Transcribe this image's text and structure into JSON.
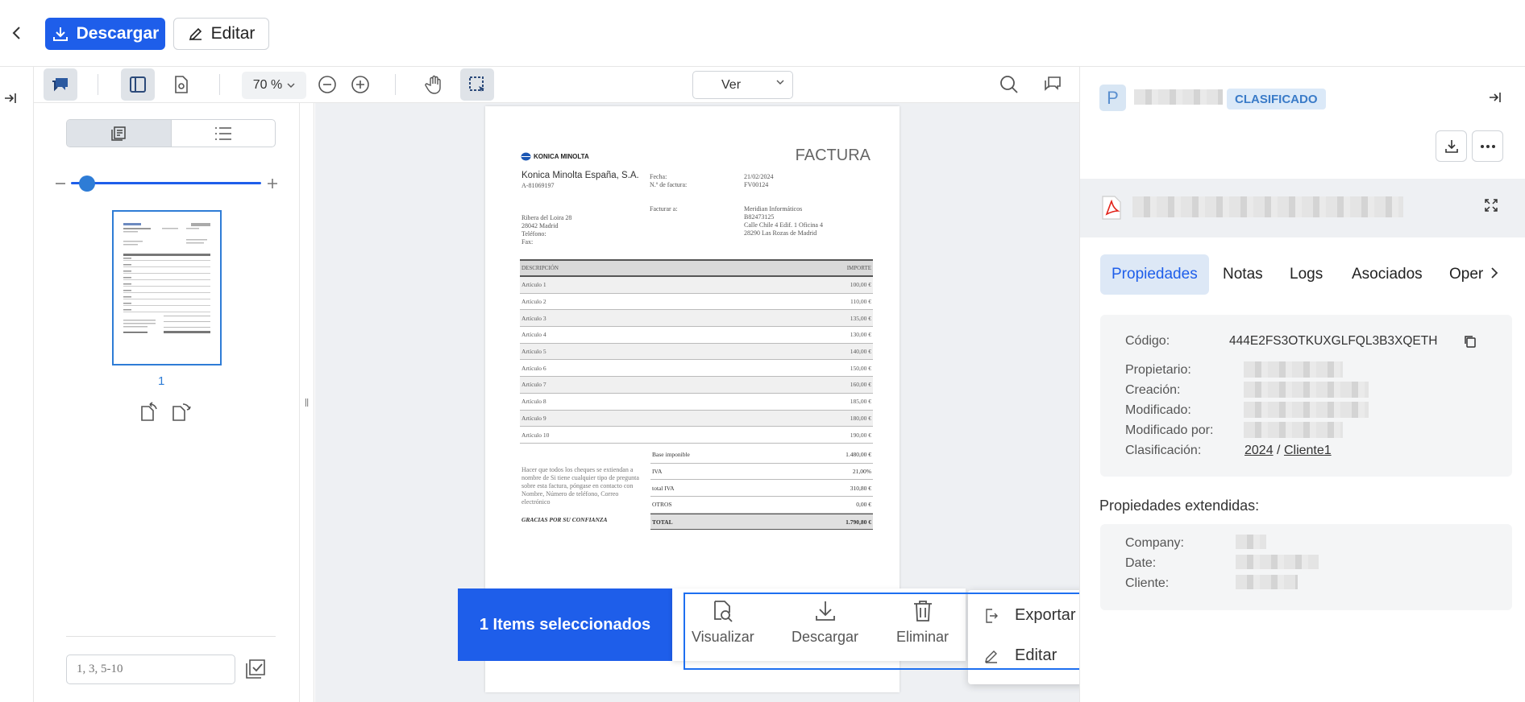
{
  "header": {
    "download_label": "Descargar",
    "edit_label": "Editar"
  },
  "toolbar": {
    "zoom": "70 %",
    "view_select": "Ver"
  },
  "thumbnails": {
    "page_label": "1",
    "page_range_placeholder": "1, 3, 5-10"
  },
  "document": {
    "company_logo": "KONICA MINOLTA",
    "company_name": "Konica Minolta España, S.A.",
    "company_id": "A-81069197",
    "title": "FACTURA",
    "fecha_label": "Fecha:",
    "fecha_value": "21/02/2024",
    "num_label": "N.º de factura:",
    "num_value": "FV00124",
    "facturar_label": "Facturar a:",
    "address": [
      "Ribera del Loira 28",
      "28042 Madrid",
      "Teléfono:",
      "Fax:"
    ],
    "bill_to": [
      "Meridian Informáticos",
      "B82473125",
      "Calle Chile 4 Edif. 1 Oficina 4",
      "28290 Las Rozas de Madrid"
    ],
    "col_desc": "DESCRIPCIÓN",
    "col_amount": "IMPORTE",
    "items": [
      {
        "desc": "Artículo 1",
        "amount": "100,00 €"
      },
      {
        "desc": "Artículo 2",
        "amount": "110,00 €"
      },
      {
        "desc": "Artículo 3",
        "amount": "135,00 €"
      },
      {
        "desc": "Artículo 4",
        "amount": "130,00 €"
      },
      {
        "desc": "Artículo 5",
        "amount": "140,00 €"
      },
      {
        "desc": "Artículo 6",
        "amount": "150,00 €"
      },
      {
        "desc": "Artículo 7",
        "amount": "160,00 €"
      },
      {
        "desc": "Artículo 8",
        "amount": "185,00 €"
      },
      {
        "desc": "Artículo 9",
        "amount": "180,00 €"
      },
      {
        "desc": "Artículo 10",
        "amount": "190,00 €"
      }
    ],
    "totals": [
      {
        "label": "Base imponible",
        "value": "1.480,00 €"
      },
      {
        "label": "IVA",
        "value": "21,00%"
      },
      {
        "label": "total IVA",
        "value": "310,80 €"
      },
      {
        "label": "OTROS",
        "value": "0,00 €"
      },
      {
        "label": "TOTAL",
        "value": "1.790,80 €"
      }
    ],
    "note": "Hacer que todos los cheques se extiendan a nombre de Si tiene cualquier tipo de pregunta sobre esta factura, póngase en contacto con Nombre, Número de teléfono, Correo electrónico",
    "thanks": "GRACIAS POR SU CONFIANZA"
  },
  "selection": {
    "count_label": "1 Items seleccionados",
    "actions": {
      "view": "Visualizar",
      "download": "Descargar",
      "delete": "Eliminar"
    },
    "menu": {
      "export": "Exportar",
      "edit": "Editar"
    }
  },
  "panel": {
    "avatar_letter": "P",
    "badge": "CLASIFICADO",
    "tabs": [
      "Propiedades",
      "Notas",
      "Logs",
      "Asociados",
      "Oper"
    ],
    "properties": {
      "codigo_label": "Código:",
      "codigo_value": "444E2FS3OTKUXGLFQL3B3XQETH",
      "propietario_label": "Propietario:",
      "creacion_label": "Creación:",
      "modificado_label": "Modificado:",
      "modificado_por_label": "Modificado por:",
      "clasificacion_label": "Clasificación:",
      "clasificacion_year": "2024",
      "clasificacion_sep": "/",
      "clasificacion_client": "Cliente1"
    },
    "extended_title": "Propiedades extendidas:",
    "extended": {
      "company_label": "Company:",
      "date_label": "Date:",
      "cliente_label": "Cliente:"
    }
  },
  "colors": {
    "accent": "#1e5eea",
    "outline": "#1e6ff0",
    "badge_bg": "#dbe9f8"
  }
}
